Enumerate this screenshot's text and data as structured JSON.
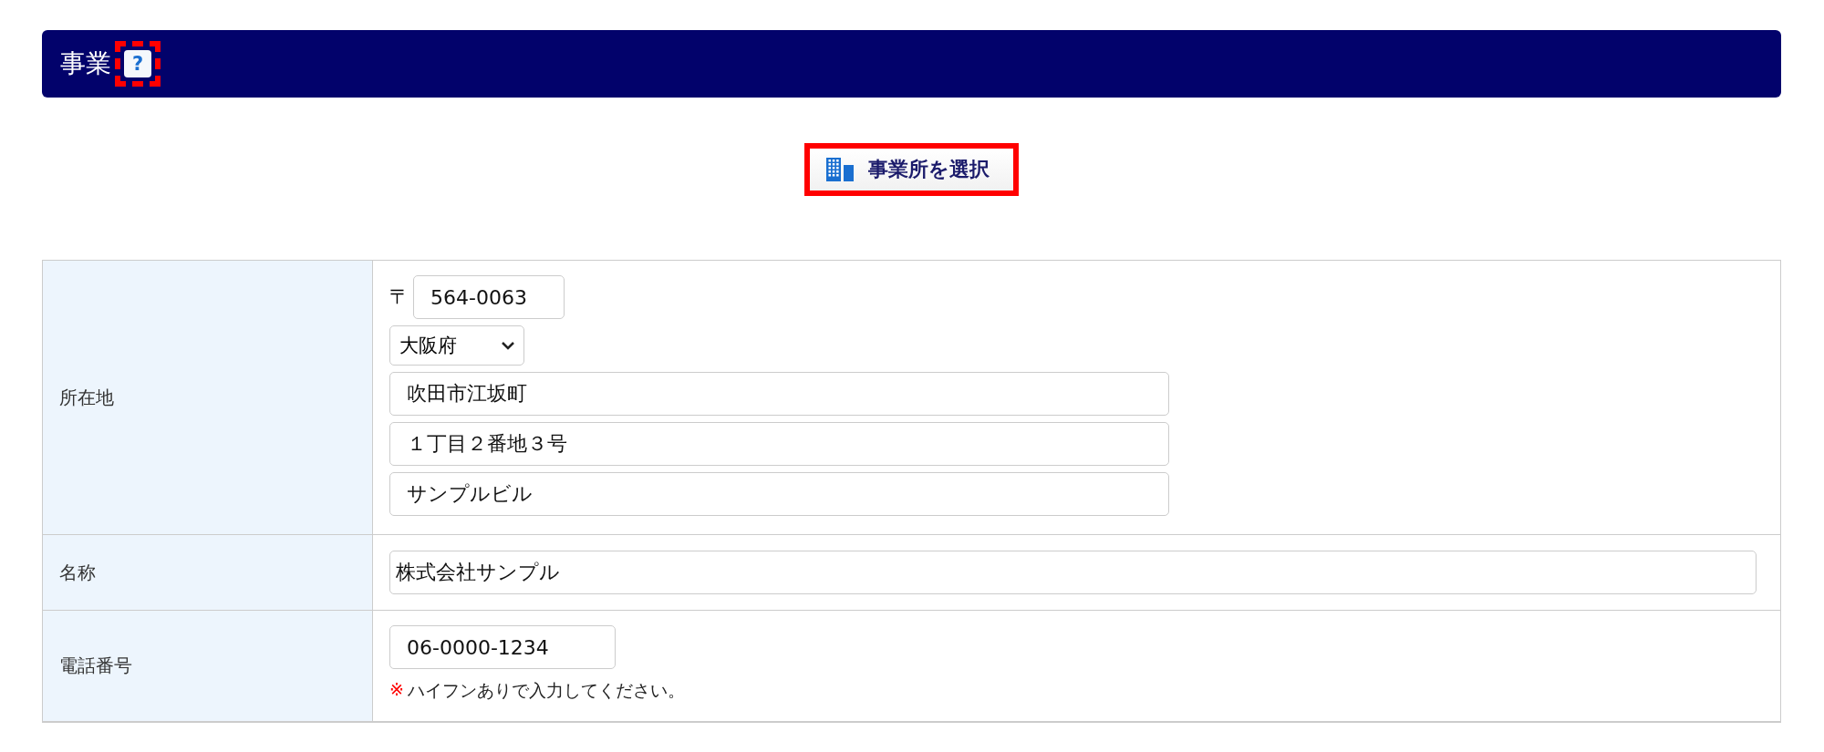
{
  "header": {
    "title": "事業",
    "help": {
      "label": "?",
      "highlighted": true
    }
  },
  "select_button": {
    "label": "事業所を選択",
    "highlighted": true
  },
  "form": {
    "rows": [
      {
        "kind": "address",
        "label": "所在地",
        "postal_mark": "〒",
        "postal_code": "564-0063",
        "prefecture": "大阪府",
        "lines": [
          "吹田市江坂町",
          "１丁目２番地３号",
          "サンプルビル"
        ]
      },
      {
        "kind": "text",
        "label": "名称",
        "value": "株式会社サンプル"
      },
      {
        "kind": "phone",
        "label": "電話番号",
        "value": "06-0000-1234",
        "note_mark": "※",
        "note": "ハイフンありで入力してください。"
      }
    ]
  }
}
